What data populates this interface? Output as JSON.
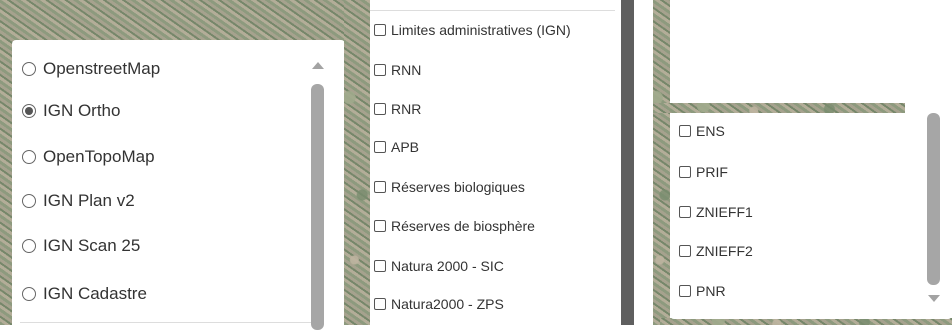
{
  "basemaps": {
    "options": [
      {
        "label": "OpenstreetMap",
        "checked": false
      },
      {
        "label": "IGN Ortho",
        "checked": true
      },
      {
        "label": "OpenTopoMap",
        "checked": false
      },
      {
        "label": "IGN Plan v2",
        "checked": false
      },
      {
        "label": "IGN Scan 25",
        "checked": false
      },
      {
        "label": "IGN Cadastre",
        "checked": false
      }
    ]
  },
  "layers_middle": {
    "items": [
      {
        "label": "Limites administratives (IGN)",
        "checked": false
      },
      {
        "label": "RNN",
        "checked": false
      },
      {
        "label": "RNR",
        "checked": false
      },
      {
        "label": "APB",
        "checked": false
      },
      {
        "label": "Réserves biologiques",
        "checked": false
      },
      {
        "label": "Réserves de biosphère",
        "checked": false
      },
      {
        "label": "Natura 2000 - SIC",
        "checked": false
      },
      {
        "label": "Natura2000 - ZPS",
        "checked": false
      }
    ]
  },
  "layers_right": {
    "items": [
      {
        "label": "ENS",
        "checked": false
      },
      {
        "label": "PRIF",
        "checked": false
      },
      {
        "label": "ZNIEFF1",
        "checked": false
      },
      {
        "label": "ZNIEFF2",
        "checked": false
      },
      {
        "label": "PNR",
        "checked": false
      }
    ]
  },
  "colors": {
    "scrollbar_thumb": "#a6a6a6",
    "panel_background": "#ffffff",
    "divider": "#5f5f5f"
  }
}
